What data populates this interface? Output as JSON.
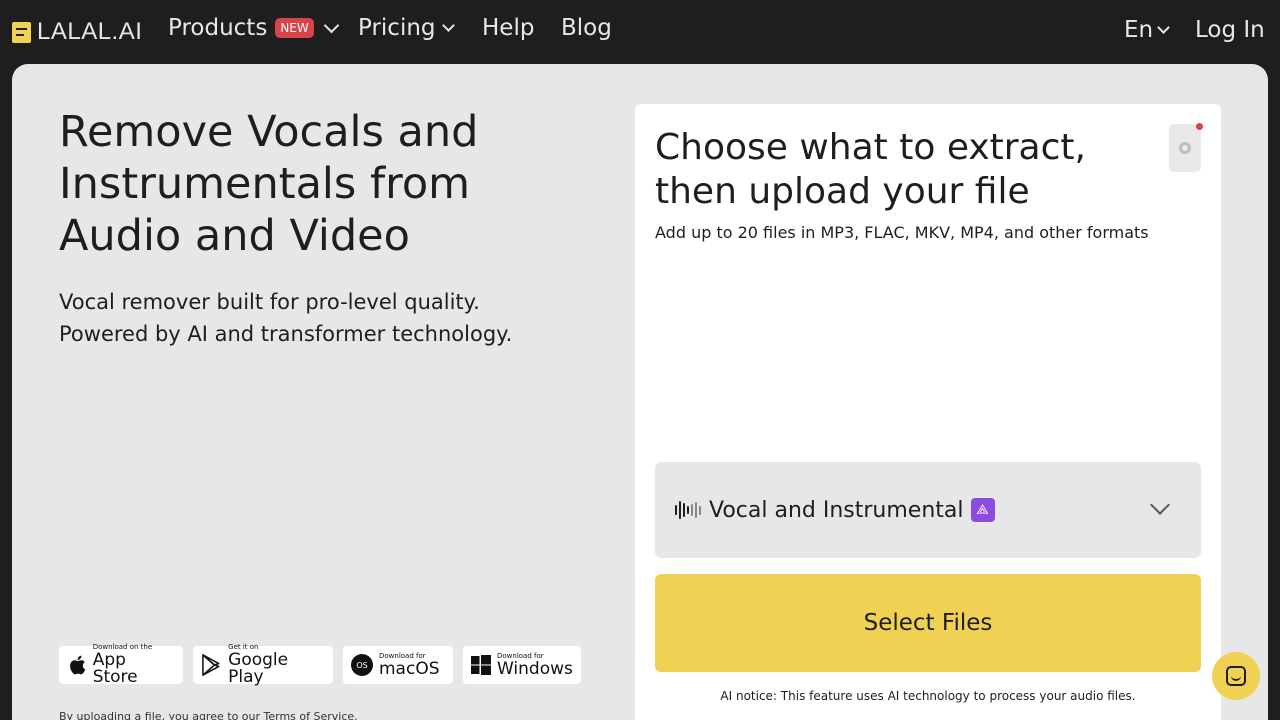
{
  "nav": {
    "logo_text": "LALAL.AI",
    "products_label": "Products",
    "new_badge": "NEW",
    "pricing_label": "Pricing",
    "help_label": "Help",
    "blog_label": "Blog",
    "language_label": "En",
    "login_label": "Log In"
  },
  "hero": {
    "title": "Remove Vocals and Instrumentals from Audio and Video",
    "subtitle_line1": "Vocal remover built for pro-level quality.",
    "subtitle_line2": "Powered by AI and transformer technology."
  },
  "downloads": [
    {
      "small": "Download on the",
      "big": "App Store",
      "icon": "apple-icon"
    },
    {
      "small": "Get it on",
      "big": "Google Play",
      "icon": "google-play-icon"
    },
    {
      "small": "Download for",
      "big": "macOS",
      "icon": "macos-icon",
      "icon_text": "OS"
    },
    {
      "small": "Download for",
      "big": "Windows",
      "icon": "windows-icon"
    }
  ],
  "terms": {
    "prefix": "By uploading a file, you agree to our ",
    "link": "Terms of Service."
  },
  "panel": {
    "title": "Choose what to extract, then upload your file",
    "subtitle": "Add up to 20 files in MP3, FLAC, MKV, MP4, and other formats",
    "stem_label": "Vocal and Instrumental",
    "select_files_label": "Select Files",
    "ai_notice": "AI notice: This feature uses AI technology to process your audio files."
  },
  "colors": {
    "accent": "#f0d153",
    "background": "#1e1e1e",
    "card": "#e7e7e7",
    "badge_red": "#d9434a",
    "ai_purple": "#8c4ce0"
  }
}
